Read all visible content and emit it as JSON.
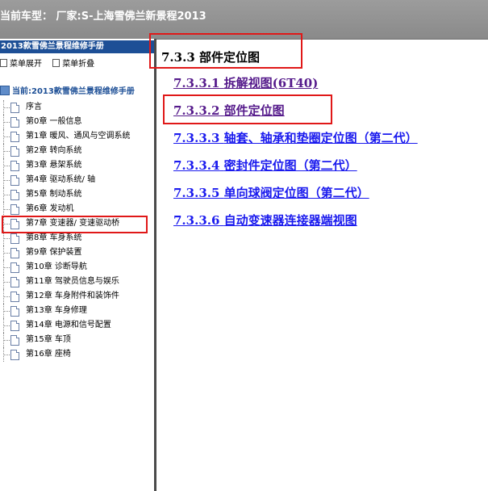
{
  "header": {
    "title": "当前车型：  厂家:S-上海雪佛兰新景程2013"
  },
  "sidebar": {
    "manual_title": "2013款雪佛兰景程维修手册",
    "expand_label": "菜单展开",
    "collapse_label": "菜单折叠",
    "root_label": "当前:2013款雪佛兰景程维修手册",
    "items": [
      {
        "label": "序言"
      },
      {
        "label": "第0章 一般信息"
      },
      {
        "label": "第1章 暖风、通风与空调系统"
      },
      {
        "label": "第2章 转向系统"
      },
      {
        "label": "第3章 悬架系统"
      },
      {
        "label": "第4章 驱动系统/ 轴"
      },
      {
        "label": "第5章 制动系统"
      },
      {
        "label": "第6章 发动机"
      },
      {
        "label": "第7章 变速器/ 变速驱动桥"
      },
      {
        "label": "第8章 车身系统"
      },
      {
        "label": "第9章 保护装置"
      },
      {
        "label": "第10章 诊断导航"
      },
      {
        "label": "第11章 驾驶员信息与娱乐"
      },
      {
        "label": "第12章 车身附件和装饰件"
      },
      {
        "label": "第13章 车身修理"
      },
      {
        "label": "第14章 电源和信号配置"
      },
      {
        "label": "第15章 车顶"
      },
      {
        "label": "第16章 座椅"
      }
    ],
    "selected_index": 8
  },
  "content": {
    "section_number": "7.3.3",
    "section_title": "部件定位图",
    "links": [
      {
        "number": "7.3.3.1",
        "text": "拆解视图(6T40)",
        "state": "visited"
      },
      {
        "number": "7.3.3.2",
        "text": "部件定位图",
        "state": "visited"
      },
      {
        "number": "7.3.3.3",
        "text": "轴套、轴承和垫圈定位图（第二代）",
        "state": "unvisited"
      },
      {
        "number": "7.3.3.4",
        "text": "密封件定位图（第二代）",
        "state": "unvisited"
      },
      {
        "number": "7.3.3.5",
        "text": "单向球阀定位图（第二代）",
        "state": "unvisited"
      },
      {
        "number": "7.3.3.6",
        "text": "自动变速器连接器端视图",
        "state": "unvisited"
      }
    ]
  },
  "colors": {
    "header_bg": "#8f8f8f",
    "sidebar_head_bg": "#1d4f96",
    "highlight": "#e01818",
    "visited_link": "#551a8b",
    "link": "#1a1aee"
  }
}
